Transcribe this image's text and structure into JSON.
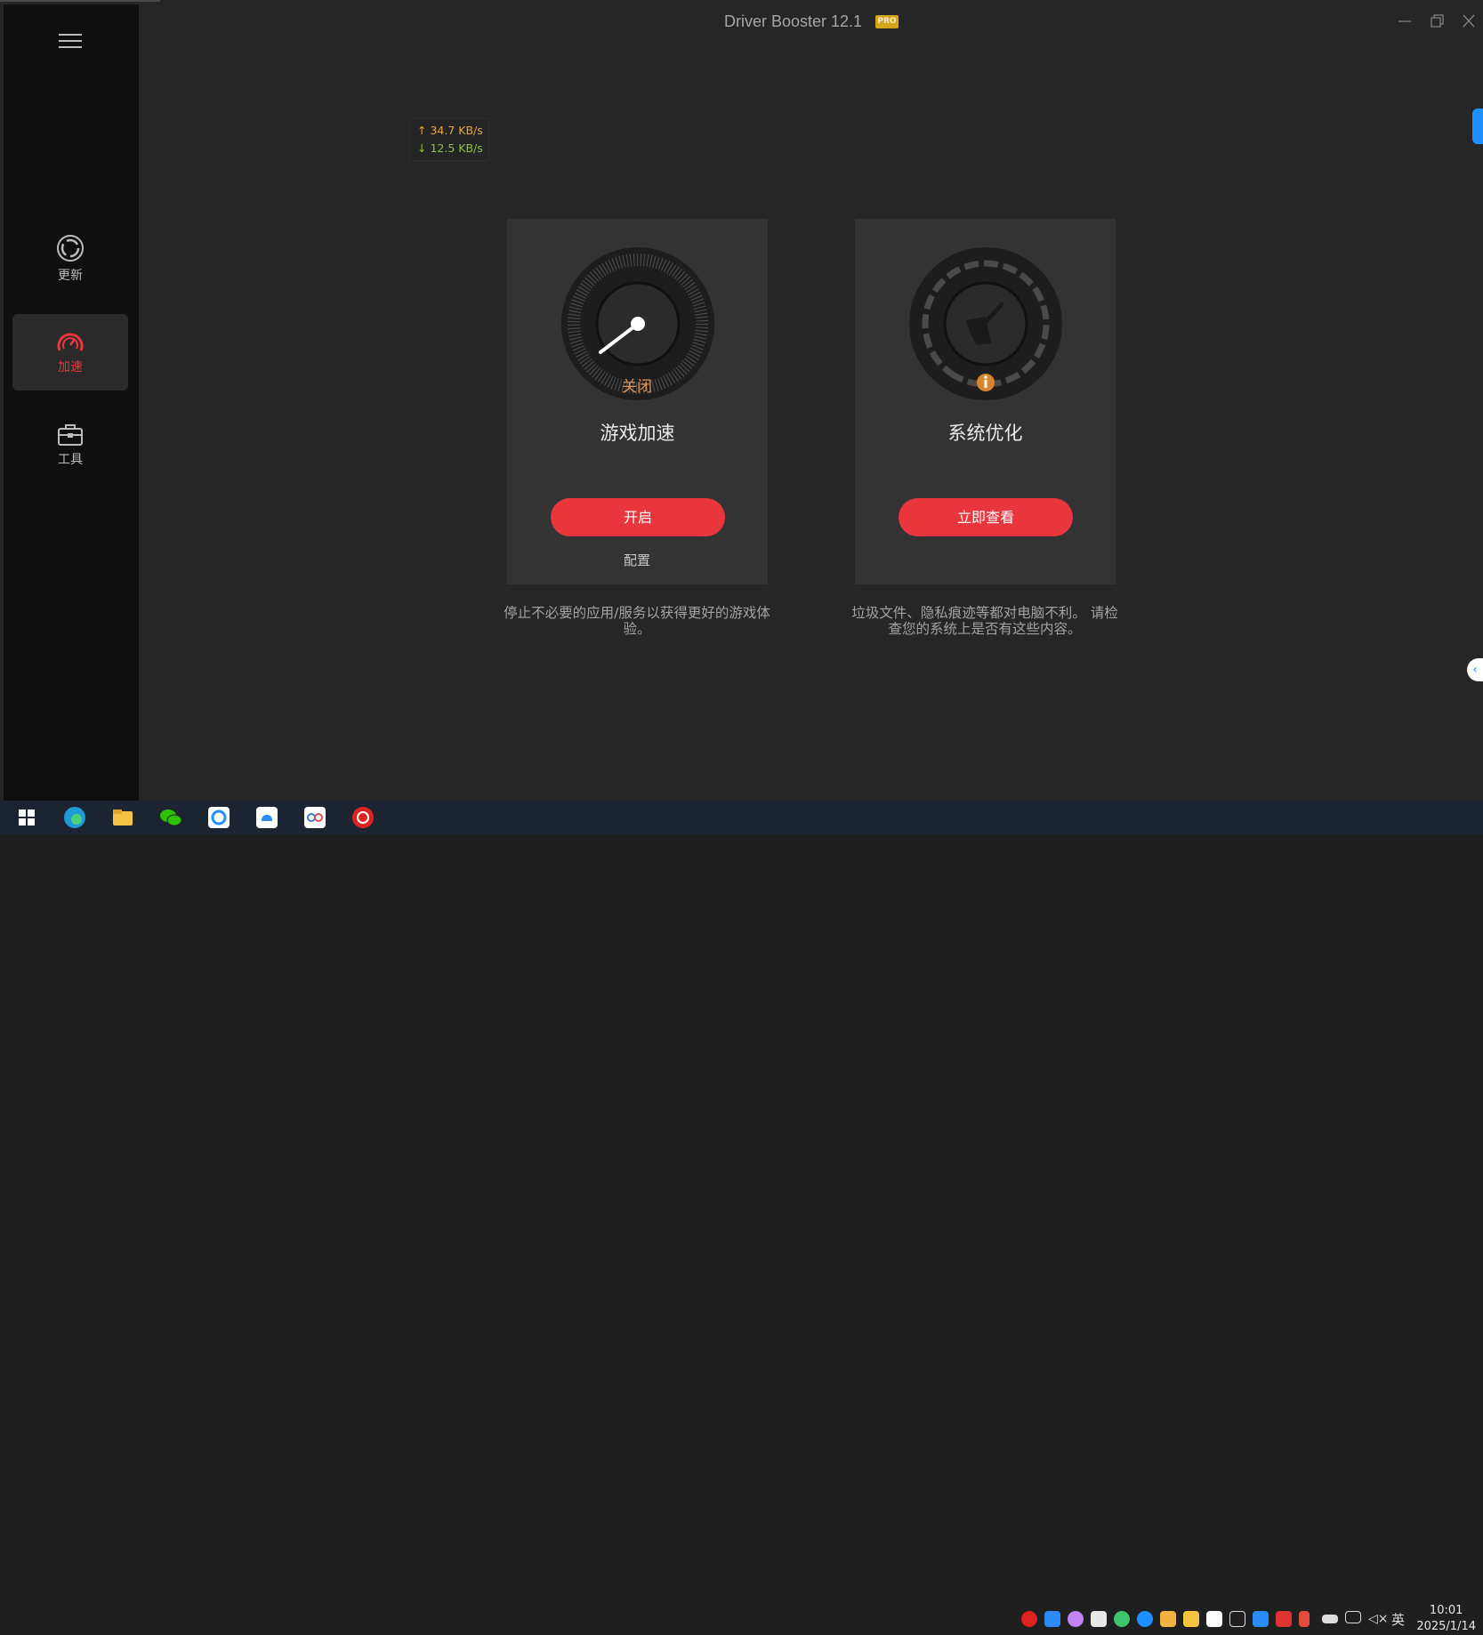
{
  "window": {
    "title": "Driver Booster 12.1",
    "badge": "PRO"
  },
  "network": {
    "upload": "↑ 34.7 KB/s",
    "download": "↓ 12.5 KB/s"
  },
  "sidebar": {
    "items": [
      {
        "label": "更新",
        "icon": "refresh-icon",
        "active": false
      },
      {
        "label": "加速",
        "icon": "speedometer-icon",
        "active": true
      },
      {
        "label": "工具",
        "icon": "toolbox-icon",
        "active": false
      }
    ]
  },
  "cards": {
    "game": {
      "dial_status": "关闭",
      "title": "游戏加速",
      "button": "开启",
      "config": "配置",
      "description": "停止不必要的应用/服务以获得更好的游戏体验。"
    },
    "system": {
      "title": "系统优化",
      "button": "立即查看",
      "description": "垃圾文件、隐私痕迹等都对电脑不利。 请检查您的系统上是否有这些内容。"
    }
  },
  "taskbar": {
    "apps": [
      "windows-start-icon",
      "edge-icon",
      "file-explorer-icon",
      "wechat-icon",
      "app-sync-icon",
      "app-cloud-icon",
      "app-share-icon",
      "driver-booster-icon"
    ],
    "language": "英",
    "time": "10:01",
    "date": "2025/1/14"
  },
  "colors": {
    "accent": "#e8363c",
    "background": "#262626",
    "sidebar": "#0f0f0f",
    "card": "#333333"
  }
}
